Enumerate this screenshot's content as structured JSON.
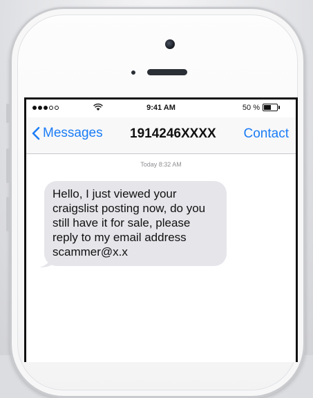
{
  "status_bar": {
    "time": "9:41 AM",
    "battery_percent": "50 %",
    "battery_level": 0.5,
    "signal_bars_filled": 3,
    "signal_bars_total": 5,
    "icons": [
      "signal-dots-icon",
      "wifi-icon",
      "battery-icon"
    ]
  },
  "nav": {
    "back_label": "Messages",
    "title": "1914246XXXX",
    "contact_label": "Contact",
    "accent_color": "#1a7cf5"
  },
  "conversation": {
    "timestamp": "Today 8:32 AM",
    "messages": [
      {
        "direction": "incoming",
        "text": "Hello, I just viewed your craigslist posting now, do you still have it for sale, please reply to my email address scammer@x.x",
        "bubble_color": "#e5e5ea"
      }
    ]
  }
}
